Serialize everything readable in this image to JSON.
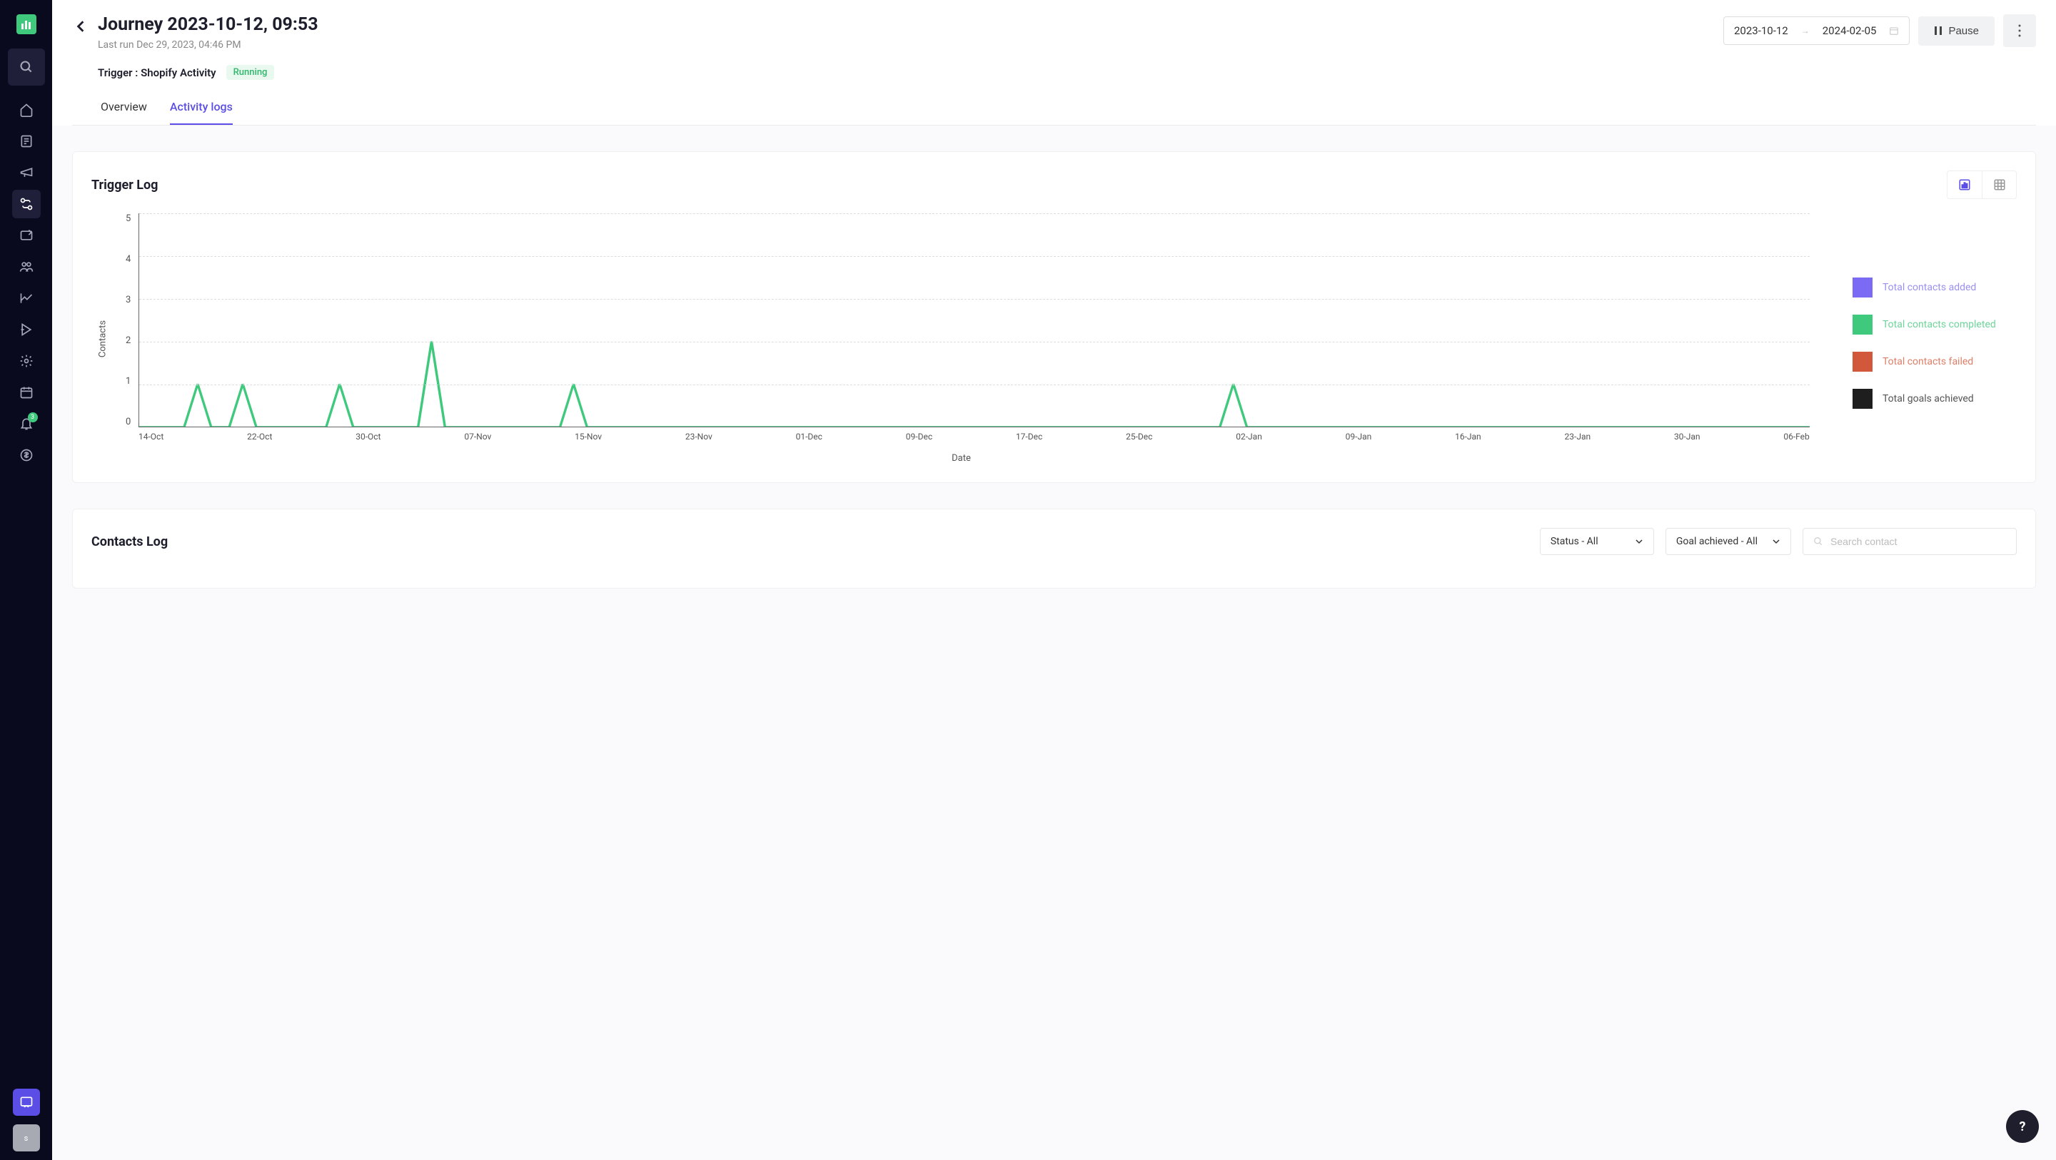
{
  "sidebar": {
    "notification_count": "3",
    "avatar_initial": "s"
  },
  "header": {
    "title": "Journey 2023-10-12, 09:53",
    "subtitle": "Last run Dec 29, 2023, 04:46 PM",
    "trigger_label": "Trigger : Shopify Activity",
    "status": "Running",
    "date_start": "2023-10-12",
    "date_end": "2024-02-05",
    "pause_label": "Pause"
  },
  "tabs": {
    "overview": "Overview",
    "activity_logs": "Activity logs"
  },
  "trigger_log": {
    "title": "Trigger Log",
    "ylabel": "Contacts",
    "xlabel": "Date",
    "legend": {
      "added": "Total contacts added",
      "completed": "Total contacts completed",
      "failed": "Total contacts failed",
      "goals": "Total goals achieved"
    }
  },
  "contacts_log": {
    "title": "Contacts Log",
    "status_filter": "Status - All",
    "goal_filter": "Goal achieved - All",
    "search_placeholder": "Search contact"
  },
  "colors": {
    "added": "#7a6af4",
    "completed": "#3ec97c",
    "failed": "#d2583b",
    "goals": "#1e1e1e"
  },
  "chart_data": {
    "type": "line",
    "xlabel": "Date",
    "ylabel": "Contacts",
    "ylim": [
      0,
      5
    ],
    "y_ticks": [
      5,
      4,
      3,
      2,
      1,
      0
    ],
    "categories": [
      "14-Oct",
      "22-Oct",
      "30-Oct",
      "07-Nov",
      "15-Nov",
      "23-Nov",
      "01-Dec",
      "09-Dec",
      "17-Dec",
      "25-Dec",
      "02-Jan",
      "09-Jan",
      "16-Jan",
      "23-Jan",
      "30-Jan",
      "06-Feb"
    ],
    "series": [
      {
        "name": "Total contacts added",
        "color": "#7a6af4",
        "values": [
          0,
          0,
          0,
          0,
          0,
          0,
          0,
          0,
          0,
          0,
          0,
          0,
          0,
          0,
          0,
          0
        ]
      },
      {
        "name": "Total contacts completed",
        "color": "#3ec97c",
        "spikes": [
          {
            "x": "18-Oct",
            "value": 1
          },
          {
            "x": "21-Oct",
            "value": 1
          },
          {
            "x": "28-Oct",
            "value": 1
          },
          {
            "x": "04-Nov",
            "value": 2
          },
          {
            "x": "14-Nov",
            "value": 1
          },
          {
            "x": "29-Dec",
            "value": 1
          }
        ]
      },
      {
        "name": "Total contacts failed",
        "color": "#d2583b",
        "values": [
          0,
          0,
          0,
          0,
          0,
          0,
          0,
          0,
          0,
          0,
          0,
          0,
          0,
          0,
          0,
          0
        ]
      },
      {
        "name": "Total goals achieved",
        "color": "#1e1e1e",
        "values": [
          0,
          0,
          0,
          0,
          0,
          0,
          0,
          0,
          0,
          0,
          0,
          0,
          0,
          0,
          0,
          0
        ]
      }
    ]
  }
}
